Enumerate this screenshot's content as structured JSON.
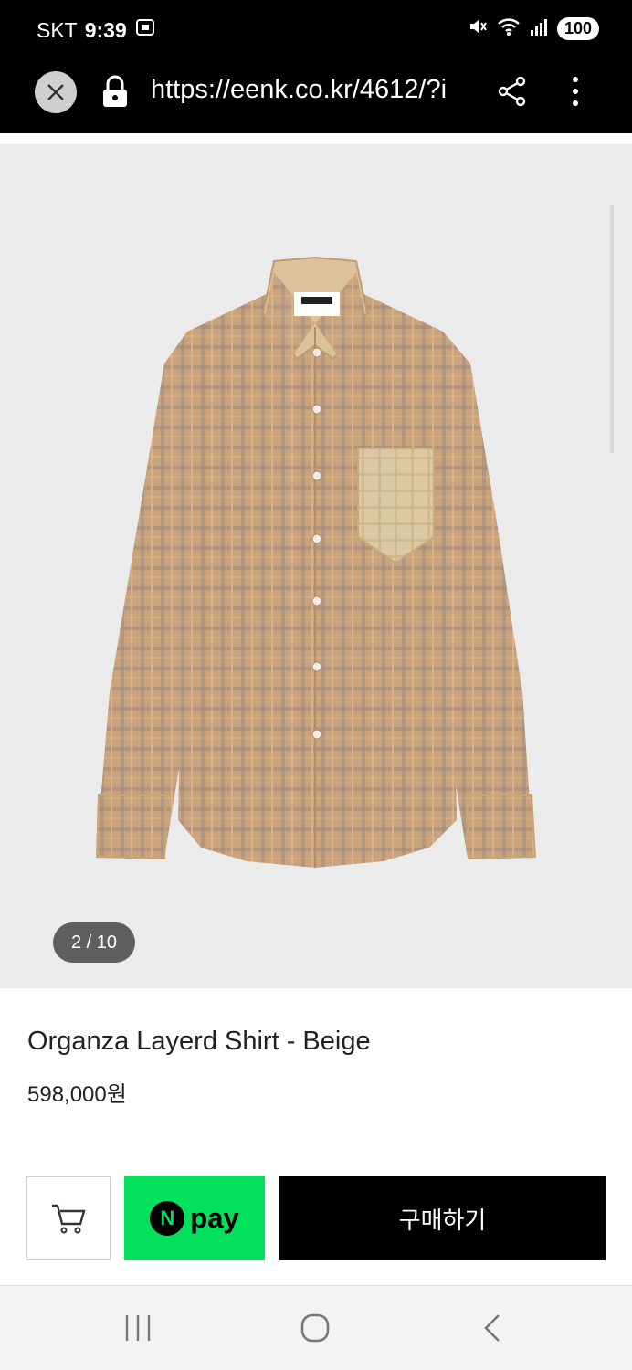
{
  "status_bar": {
    "carrier": "SKT",
    "time": "9:39",
    "battery": "100",
    "icons": [
      "screenshot-icon",
      "mute-icon",
      "wifi-icon",
      "signal-icon"
    ]
  },
  "browser": {
    "url": "https://eenk.co.kr/4612/?i",
    "icons": [
      "close-icon",
      "lock-icon",
      "share-icon",
      "more-icon"
    ]
  },
  "gallery": {
    "counter": "2 / 10",
    "background_color": "#ebebeb"
  },
  "product": {
    "title": "Organza Layerd Shirt - Beige",
    "price": "598,000원"
  },
  "actions": {
    "npay_badge": "N",
    "npay_label": "pay",
    "buy_label": "구매하기",
    "npay_color": "#03e05b"
  },
  "nav": {
    "icons": [
      "recent-apps-icon",
      "home-icon",
      "back-icon"
    ]
  }
}
